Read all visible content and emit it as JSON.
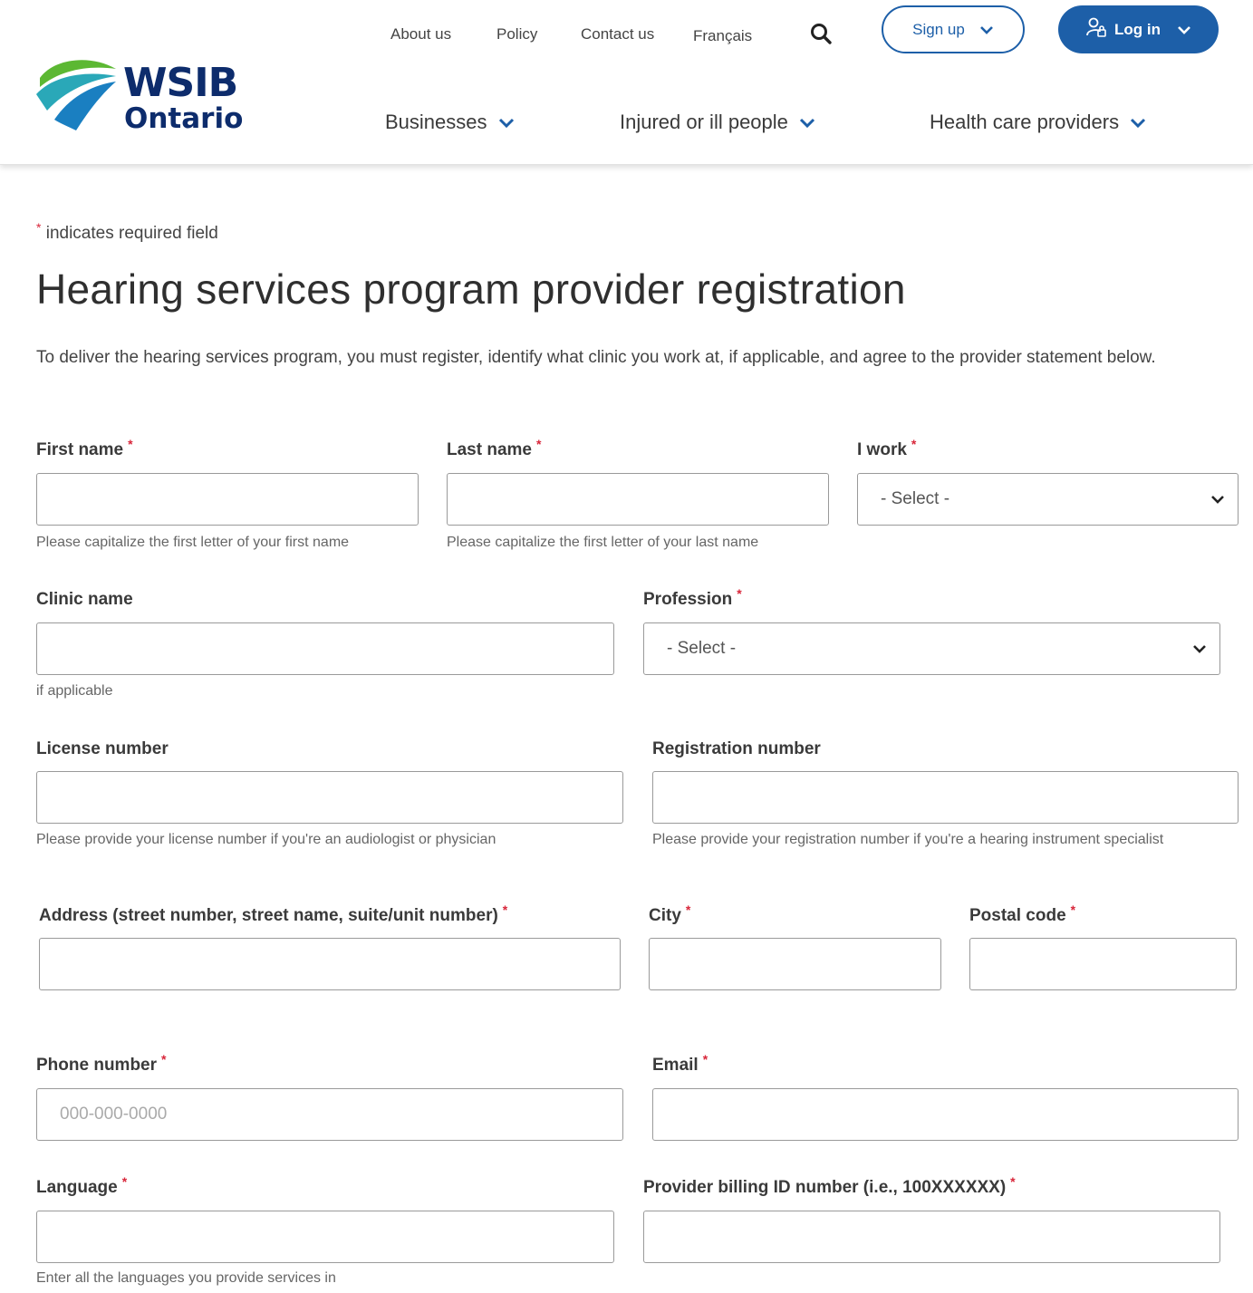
{
  "header": {
    "logo": {
      "line1": "WSIB",
      "line2": "Ontario"
    },
    "utility_nav": [
      "About us",
      "Policy",
      "Contact us",
      "Français"
    ],
    "signup_label": "Sign up",
    "login_label": "Log in",
    "main_nav": [
      "Businesses",
      "Injured or ill people",
      "Health care providers"
    ]
  },
  "form": {
    "required_note": "indicates required field",
    "title": "Hearing services program provider registration",
    "intro": "To deliver the hearing services program, you must register, identify what clinic you work at, if applicable, and agree to the provider statement below.",
    "fields": {
      "first_name": {
        "label": "First name",
        "value": "",
        "help": "Please capitalize the first letter of your first name"
      },
      "last_name": {
        "label": "Last name",
        "value": "",
        "help": "Please capitalize the first letter of your last name"
      },
      "i_work": {
        "label": "I work",
        "selected": "- Select -"
      },
      "clinic_name": {
        "label": "Clinic name",
        "value": "",
        "help": "if applicable"
      },
      "profession": {
        "label": "Profession",
        "selected": "- Select -"
      },
      "license_number": {
        "label": "License number",
        "value": "",
        "help": "Please provide your license number if you're an audiologist or physician"
      },
      "registration_number": {
        "label": "Registration number",
        "value": "",
        "help": "Please provide your registration number if you're a hearing instrument specialist"
      },
      "address": {
        "label": "Address (street number, street name, suite/unit number)",
        "value": ""
      },
      "city": {
        "label": "City",
        "value": ""
      },
      "postal_code": {
        "label": "Postal code",
        "value": ""
      },
      "phone": {
        "label": "Phone number",
        "value": "",
        "placeholder": "000-000-0000"
      },
      "email": {
        "label": "Email",
        "value": ""
      },
      "language": {
        "label": "Language",
        "value": "",
        "help": "Enter all the languages you provide services in"
      },
      "billing_id": {
        "label": "Provider billing ID number (i.e., 100XXXXXX)",
        "value": ""
      }
    }
  },
  "colors": {
    "brand_blue": "#1d5fa8",
    "logo_navy": "#0d2c6c",
    "required_star": "#d8263a"
  }
}
